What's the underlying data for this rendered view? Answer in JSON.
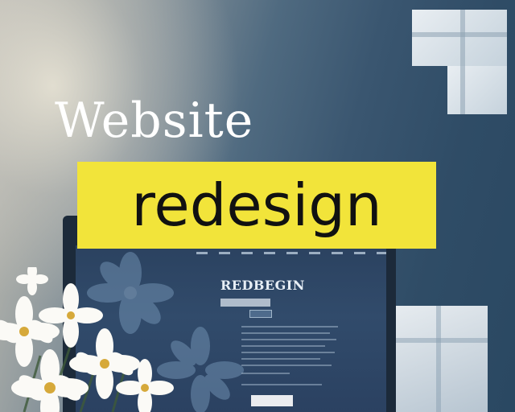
{
  "heading": {
    "line1": "Website",
    "line2": "redesign"
  },
  "screen": {
    "brand": "REDBEGIN"
  },
  "colors": {
    "banner": "#f2e43a",
    "heading_text": "#ffffff",
    "background_dark": "#2f4c66"
  },
  "icons": [
    "flower-icon",
    "window-tile-icon"
  ]
}
